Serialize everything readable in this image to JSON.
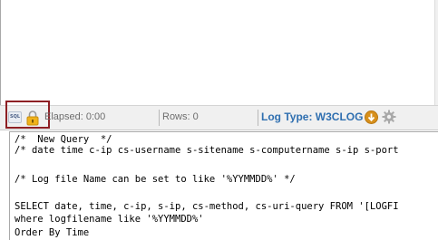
{
  "status_bar": {
    "sql_icon_text": "SQL",
    "elapsed": "Elapsed: 0:00",
    "rows": "Rows: 0",
    "log_type": "Log Type: W3CLOG",
    "icons": [
      "sql-icon",
      "lock-icon",
      "arrow-down-circle-icon",
      "gear-icon"
    ],
    "colors": {
      "log_type": "#2f6fb0",
      "highlight_border": "#8e1f24",
      "lock": "#f0b21a"
    }
  },
  "editor": {
    "lines": [
      "/*  New Query  */",
      "/* date time c-ip cs-username s-sitename s-computername s-ip s-port",
      "",
      "/* Log file Name can be set to like '%YYMMDD%' */",
      "",
      "SELECT date, time, c-ip, s-ip, cs-method, cs-uri-query FROM '[LOGFI",
      "where logfilename like '%YYMMDD%'",
      "Order By Time"
    ]
  }
}
